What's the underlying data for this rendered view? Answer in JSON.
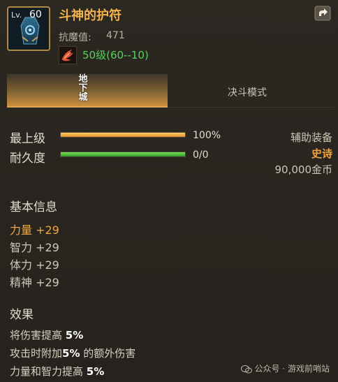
{
  "item": {
    "lv_label": "Lv.",
    "level": "60",
    "name": "斗神的护符",
    "stat_label": "抗魔值:",
    "stat_value": "471",
    "level_range": "50级(60--10)",
    "icon": "amulet-icon",
    "skill_icon": "phoenix-wing-icon"
  },
  "tabs": [
    {
      "label": "地下城",
      "active": true
    },
    {
      "label": "决斗模式",
      "active": false
    }
  ],
  "bars": {
    "max_level": {
      "label": "最上级",
      "value_text": "100%",
      "fill": 1.0
    },
    "durability": {
      "label": "耐久度",
      "value_text": "0/0",
      "fill": 1.0
    }
  },
  "side_info": {
    "type": "辅助装备",
    "rarity": "史诗",
    "price": "90,000金币"
  },
  "basic_info": {
    "title": "基本信息",
    "attrs": [
      {
        "text": "力量 +29"
      },
      {
        "text": "智力 +29"
      },
      {
        "text": "体力 +29"
      },
      {
        "text": "精神 +29"
      }
    ]
  },
  "effects": {
    "title": "效果",
    "lines": [
      {
        "pre": "将伤害提高 ",
        "bold": "5%",
        "post": ""
      },
      {
        "pre": "攻击时附加",
        "bold": "5%",
        "post": " 的额外伤害"
      },
      {
        "pre": "力量和智力提高 ",
        "bold": "5%",
        "post": ""
      }
    ]
  },
  "watermark": "公众号 · 游戏前哨站",
  "colors": {
    "title": "#f0b24b",
    "level_green": "#56d25a",
    "rarity": "#f0a640",
    "bar_orange": "#e4902c",
    "bar_green": "#2d9b27"
  }
}
